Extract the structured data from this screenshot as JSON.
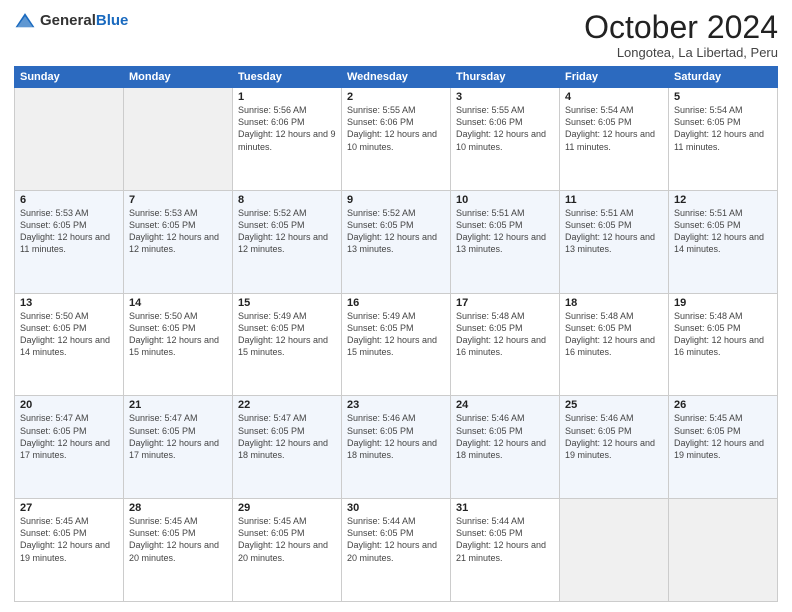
{
  "header": {
    "logo_general": "General",
    "logo_blue": "Blue",
    "month_title": "October 2024",
    "location": "Longotea, La Libertad, Peru"
  },
  "weekdays": [
    "Sunday",
    "Monday",
    "Tuesday",
    "Wednesday",
    "Thursday",
    "Friday",
    "Saturday"
  ],
  "weeks": [
    [
      {
        "day": "",
        "sunrise": "",
        "sunset": "",
        "daylight": "",
        "empty": true
      },
      {
        "day": "",
        "sunrise": "",
        "sunset": "",
        "daylight": "",
        "empty": true
      },
      {
        "day": "1",
        "sunrise": "Sunrise: 5:56 AM",
        "sunset": "Sunset: 6:06 PM",
        "daylight": "Daylight: 12 hours and 9 minutes."
      },
      {
        "day": "2",
        "sunrise": "Sunrise: 5:55 AM",
        "sunset": "Sunset: 6:06 PM",
        "daylight": "Daylight: 12 hours and 10 minutes."
      },
      {
        "day": "3",
        "sunrise": "Sunrise: 5:55 AM",
        "sunset": "Sunset: 6:06 PM",
        "daylight": "Daylight: 12 hours and 10 minutes."
      },
      {
        "day": "4",
        "sunrise": "Sunrise: 5:54 AM",
        "sunset": "Sunset: 6:05 PM",
        "daylight": "Daylight: 12 hours and 11 minutes."
      },
      {
        "day": "5",
        "sunrise": "Sunrise: 5:54 AM",
        "sunset": "Sunset: 6:05 PM",
        "daylight": "Daylight: 12 hours and 11 minutes."
      }
    ],
    [
      {
        "day": "6",
        "sunrise": "Sunrise: 5:53 AM",
        "sunset": "Sunset: 6:05 PM",
        "daylight": "Daylight: 12 hours and 11 minutes."
      },
      {
        "day": "7",
        "sunrise": "Sunrise: 5:53 AM",
        "sunset": "Sunset: 6:05 PM",
        "daylight": "Daylight: 12 hours and 12 minutes."
      },
      {
        "day": "8",
        "sunrise": "Sunrise: 5:52 AM",
        "sunset": "Sunset: 6:05 PM",
        "daylight": "Daylight: 12 hours and 12 minutes."
      },
      {
        "day": "9",
        "sunrise": "Sunrise: 5:52 AM",
        "sunset": "Sunset: 6:05 PM",
        "daylight": "Daylight: 12 hours and 13 minutes."
      },
      {
        "day": "10",
        "sunrise": "Sunrise: 5:51 AM",
        "sunset": "Sunset: 6:05 PM",
        "daylight": "Daylight: 12 hours and 13 minutes."
      },
      {
        "day": "11",
        "sunrise": "Sunrise: 5:51 AM",
        "sunset": "Sunset: 6:05 PM",
        "daylight": "Daylight: 12 hours and 13 minutes."
      },
      {
        "day": "12",
        "sunrise": "Sunrise: 5:51 AM",
        "sunset": "Sunset: 6:05 PM",
        "daylight": "Daylight: 12 hours and 14 minutes."
      }
    ],
    [
      {
        "day": "13",
        "sunrise": "Sunrise: 5:50 AM",
        "sunset": "Sunset: 6:05 PM",
        "daylight": "Daylight: 12 hours and 14 minutes."
      },
      {
        "day": "14",
        "sunrise": "Sunrise: 5:50 AM",
        "sunset": "Sunset: 6:05 PM",
        "daylight": "Daylight: 12 hours and 15 minutes."
      },
      {
        "day": "15",
        "sunrise": "Sunrise: 5:49 AM",
        "sunset": "Sunset: 6:05 PM",
        "daylight": "Daylight: 12 hours and 15 minutes."
      },
      {
        "day": "16",
        "sunrise": "Sunrise: 5:49 AM",
        "sunset": "Sunset: 6:05 PM",
        "daylight": "Daylight: 12 hours and 15 minutes."
      },
      {
        "day": "17",
        "sunrise": "Sunrise: 5:48 AM",
        "sunset": "Sunset: 6:05 PM",
        "daylight": "Daylight: 12 hours and 16 minutes."
      },
      {
        "day": "18",
        "sunrise": "Sunrise: 5:48 AM",
        "sunset": "Sunset: 6:05 PM",
        "daylight": "Daylight: 12 hours and 16 minutes."
      },
      {
        "day": "19",
        "sunrise": "Sunrise: 5:48 AM",
        "sunset": "Sunset: 6:05 PM",
        "daylight": "Daylight: 12 hours and 16 minutes."
      }
    ],
    [
      {
        "day": "20",
        "sunrise": "Sunrise: 5:47 AM",
        "sunset": "Sunset: 6:05 PM",
        "daylight": "Daylight: 12 hours and 17 minutes."
      },
      {
        "day": "21",
        "sunrise": "Sunrise: 5:47 AM",
        "sunset": "Sunset: 6:05 PM",
        "daylight": "Daylight: 12 hours and 17 minutes."
      },
      {
        "day": "22",
        "sunrise": "Sunrise: 5:47 AM",
        "sunset": "Sunset: 6:05 PM",
        "daylight": "Daylight: 12 hours and 18 minutes."
      },
      {
        "day": "23",
        "sunrise": "Sunrise: 5:46 AM",
        "sunset": "Sunset: 6:05 PM",
        "daylight": "Daylight: 12 hours and 18 minutes."
      },
      {
        "day": "24",
        "sunrise": "Sunrise: 5:46 AM",
        "sunset": "Sunset: 6:05 PM",
        "daylight": "Daylight: 12 hours and 18 minutes."
      },
      {
        "day": "25",
        "sunrise": "Sunrise: 5:46 AM",
        "sunset": "Sunset: 6:05 PM",
        "daylight": "Daylight: 12 hours and 19 minutes."
      },
      {
        "day": "26",
        "sunrise": "Sunrise: 5:45 AM",
        "sunset": "Sunset: 6:05 PM",
        "daylight": "Daylight: 12 hours and 19 minutes."
      }
    ],
    [
      {
        "day": "27",
        "sunrise": "Sunrise: 5:45 AM",
        "sunset": "Sunset: 6:05 PM",
        "daylight": "Daylight: 12 hours and 19 minutes."
      },
      {
        "day": "28",
        "sunrise": "Sunrise: 5:45 AM",
        "sunset": "Sunset: 6:05 PM",
        "daylight": "Daylight: 12 hours and 20 minutes."
      },
      {
        "day": "29",
        "sunrise": "Sunrise: 5:45 AM",
        "sunset": "Sunset: 6:05 PM",
        "daylight": "Daylight: 12 hours and 20 minutes."
      },
      {
        "day": "30",
        "sunrise": "Sunrise: 5:44 AM",
        "sunset": "Sunset: 6:05 PM",
        "daylight": "Daylight: 12 hours and 20 minutes."
      },
      {
        "day": "31",
        "sunrise": "Sunrise: 5:44 AM",
        "sunset": "Sunset: 6:05 PM",
        "daylight": "Daylight: 12 hours and 21 minutes."
      },
      {
        "day": "",
        "sunrise": "",
        "sunset": "",
        "daylight": "",
        "empty": true
      },
      {
        "day": "",
        "sunrise": "",
        "sunset": "",
        "daylight": "",
        "empty": true
      }
    ]
  ]
}
